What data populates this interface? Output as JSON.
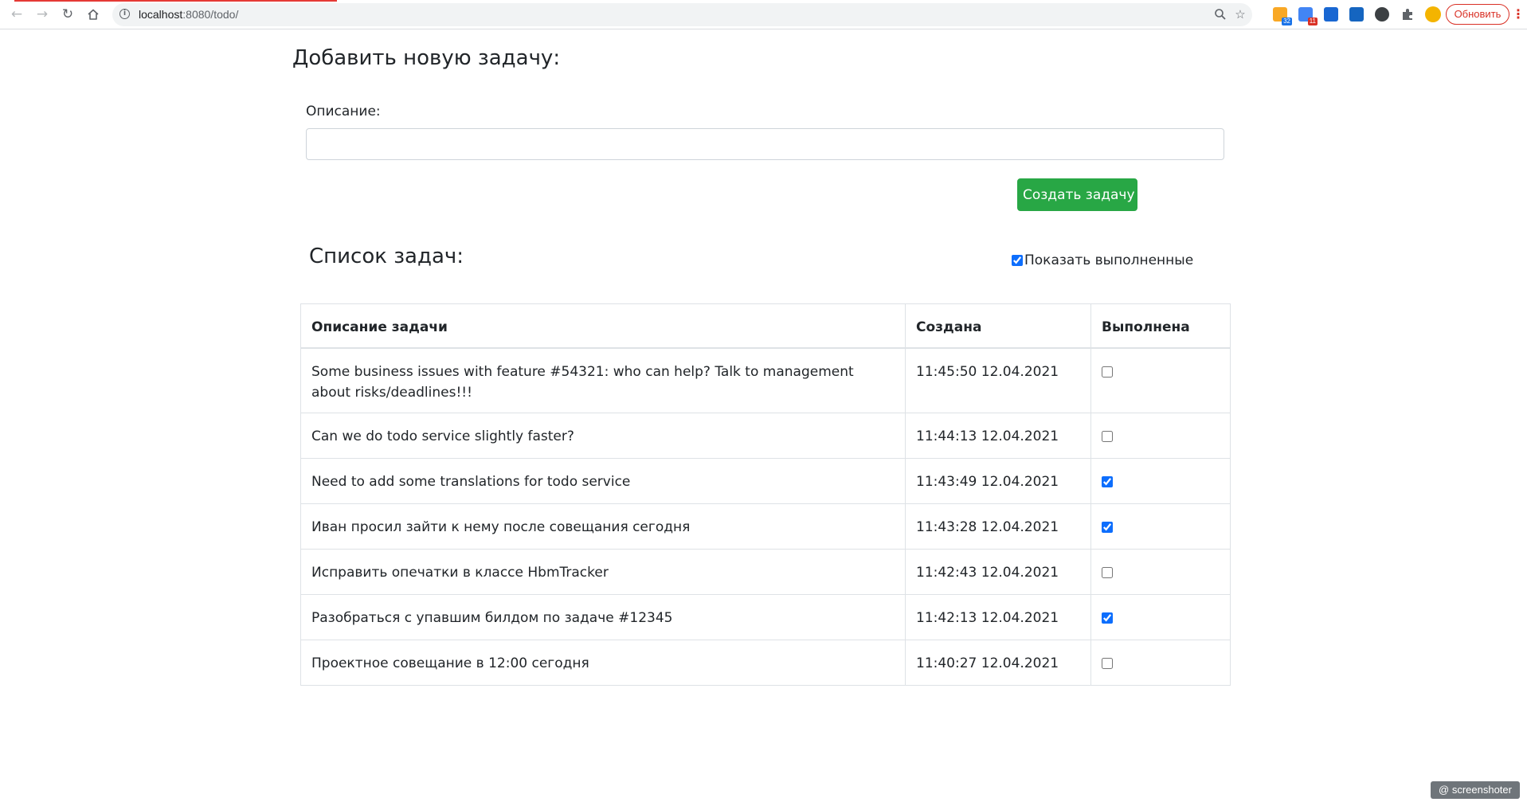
{
  "browser": {
    "url_host": "localhost",
    "url_path": ":8080/todo/",
    "update_label": "Обновить",
    "ext_badge_1": "32",
    "ext_badge_2": "11",
    "info_glyph": "i",
    "icons": [
      "back-arrow-icon",
      "forward-arrow-icon",
      "reload-icon",
      "home-icon",
      "site-info-icon",
      "zoom-icon",
      "bookmark-star-icon",
      "extensions-puzzle-icon",
      "profile-avatar-icon",
      "menu-dots-icon"
    ]
  },
  "add_form": {
    "heading": "Добавить новую задачу:",
    "description_label": "Описание:",
    "description_value": "",
    "description_placeholder": "",
    "submit_label": "Создать задачу"
  },
  "task_list": {
    "heading": "Список задач:",
    "show_done_label": "Показать выполненные",
    "show_done_checked": true,
    "columns": [
      "Описание задачи",
      "Создана",
      "Выполнена"
    ],
    "rows": [
      {
        "description": "Some business issues with feature #54321: who can help? Talk to management about risks/deadlines!!!",
        "created": "11:45:50 12.04.2021",
        "done": false
      },
      {
        "description": "Can we do todo service slightly faster?",
        "created": "11:44:13 12.04.2021",
        "done": false
      },
      {
        "description": "Need to add some translations for todo service",
        "created": "11:43:49 12.04.2021",
        "done": true
      },
      {
        "description": "Иван просил зайти к нему после совещания сегодня",
        "created": "11:43:28 12.04.2021",
        "done": true
      },
      {
        "description": "Исправить опечатки в классе HbmTracker",
        "created": "11:42:43 12.04.2021",
        "done": false
      },
      {
        "description": "Разобраться с упавшим билдом по задаче #12345",
        "created": "11:42:13 12.04.2021",
        "done": true
      },
      {
        "description": "Проектное совещание в 12:00 сегодня",
        "created": "11:40:27 12.04.2021",
        "done": false
      }
    ]
  },
  "watermark": "@ screenshoter",
  "colors": {
    "success": "#28a745",
    "checkbox": "#0d6efd",
    "update_red": "#d93025",
    "load_bar": "#e53935"
  }
}
